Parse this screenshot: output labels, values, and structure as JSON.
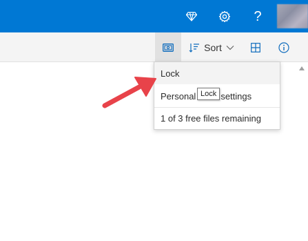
{
  "topbar": {
    "color": "#0078d4",
    "icons": [
      "diamond-icon",
      "gear-icon",
      "help-icon"
    ],
    "help_glyph": "?"
  },
  "commandbar": {
    "sort_label": "Sort",
    "sort_glyph": "⇂",
    "chevron_glyph": "⌵"
  },
  "menu": {
    "items": [
      {
        "label": "Lock"
      },
      {
        "label": "Personal Vault settings"
      },
      {
        "label": "1 of 3 free files remaining"
      }
    ],
    "personal_prefix": "Personal",
    "personal_suffix": "settings"
  },
  "tooltip": {
    "text": "Lock"
  },
  "annotation": {
    "color": "#e8434a"
  }
}
